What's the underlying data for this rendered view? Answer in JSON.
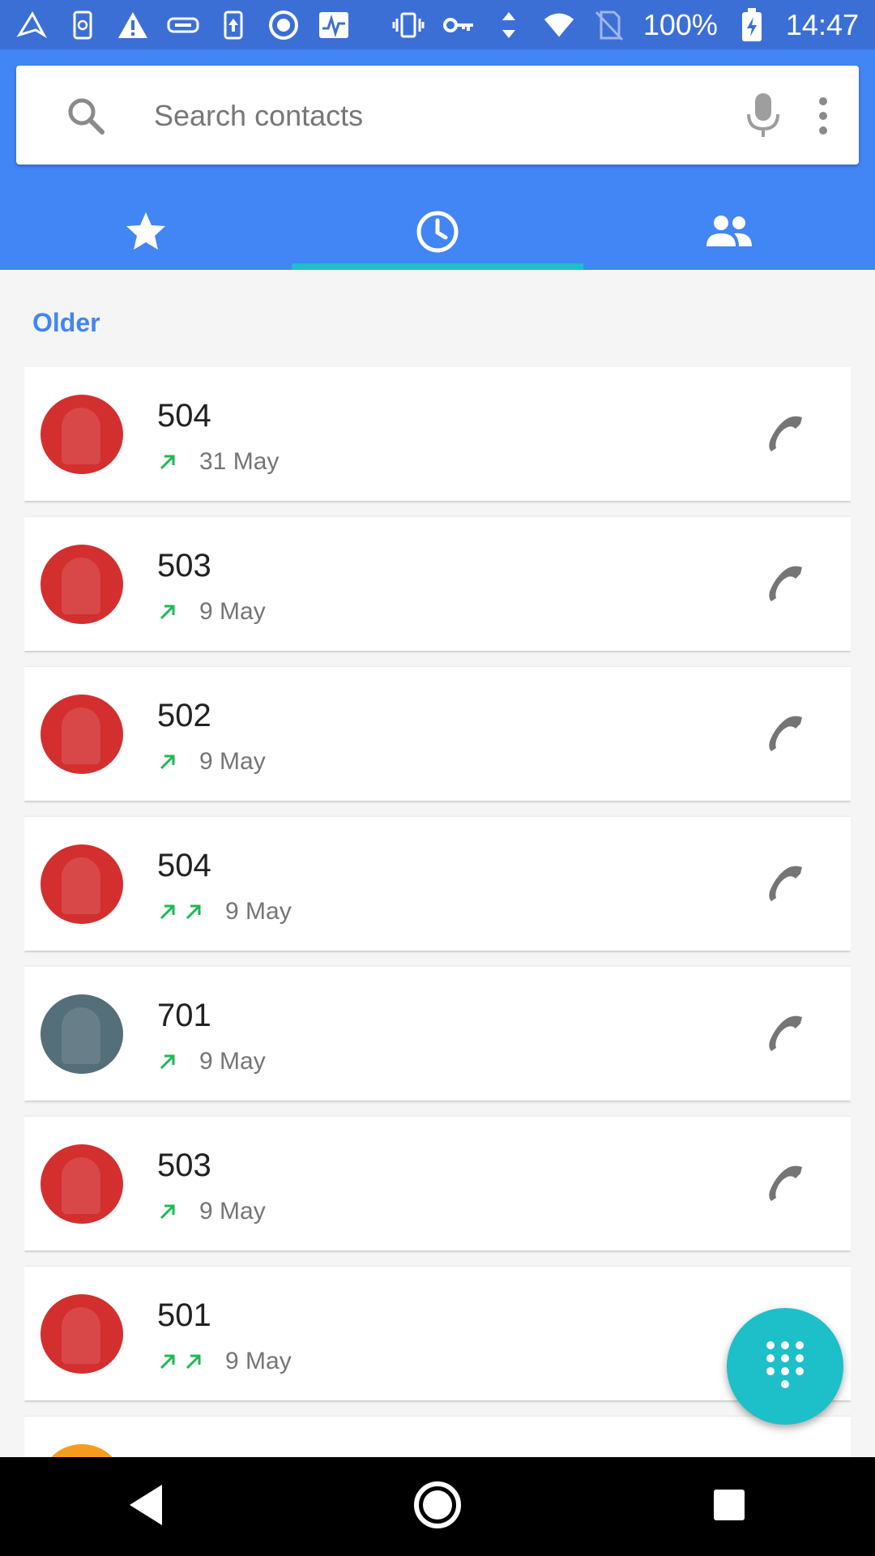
{
  "status_bar": {
    "battery_text": "100%",
    "time": "14:47",
    "left_icons": [
      "app-icon",
      "sync-icon",
      "warning-icon",
      "usb-icon",
      "upload-icon",
      "circle-app-icon",
      "activity-icon"
    ],
    "right_icons": [
      "vibrate-icon",
      "vpn-key-icon",
      "data-arrows-icon",
      "wifi-icon",
      "no-sim-icon",
      "battery-charging-icon"
    ]
  },
  "search": {
    "placeholder": "Search contacts",
    "value": ""
  },
  "tabs": [
    {
      "name": "favorites",
      "icon": "star-icon",
      "active": false
    },
    {
      "name": "recents",
      "icon": "clock-icon",
      "active": true
    },
    {
      "name": "contacts",
      "icon": "people-icon",
      "active": false
    }
  ],
  "section": {
    "label": "Older"
  },
  "calls": [
    {
      "number": "504",
      "date": "31 May",
      "outgoing_count": 1,
      "avatar_color": "#d32f2f"
    },
    {
      "number": "503",
      "date": "9 May",
      "outgoing_count": 1,
      "avatar_color": "#d32f2f"
    },
    {
      "number": "502",
      "date": "9 May",
      "outgoing_count": 1,
      "avatar_color": "#d32f2f"
    },
    {
      "number": "504",
      "date": "9 May",
      "outgoing_count": 2,
      "avatar_color": "#d32f2f"
    },
    {
      "number": "701",
      "date": "9 May",
      "outgoing_count": 1,
      "avatar_color": "#546e7a"
    },
    {
      "number": "503",
      "date": "9 May",
      "outgoing_count": 1,
      "avatar_color": "#d32f2f"
    },
    {
      "number": "501",
      "date": "9 May",
      "outgoing_count": 2,
      "avatar_color": "#d32f2f"
    },
    {
      "number": "",
      "date": "",
      "outgoing_count": 0,
      "avatar_color": "#f59c1e"
    }
  ],
  "colors": {
    "status_bar": "#3c6fd6",
    "header": "#4285f4",
    "accent": "#1dbfc8",
    "outgoing_arrow": "#1db954"
  },
  "fab": {
    "icon": "dialpad-icon"
  },
  "nav": {
    "icons": [
      "back-icon",
      "home-icon",
      "recents-icon"
    ]
  }
}
